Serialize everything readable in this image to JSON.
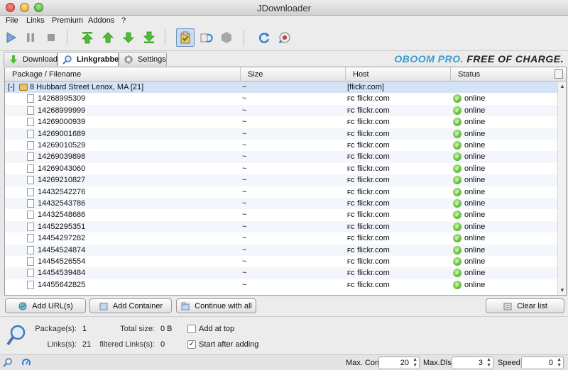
{
  "window": {
    "title": "JDownloader"
  },
  "menu": [
    "File",
    "Links",
    "Premium",
    "Addons",
    "?"
  ],
  "toolbar": {
    "icons": [
      "play-icon",
      "pause-icon",
      "stop-icon",
      "move-top-icon",
      "move-up-icon",
      "move-down-icon",
      "move-bottom-icon",
      "clipboard-observer-icon",
      "reconnect-icon",
      "premium-icon",
      "update-icon",
      "refresh-icon"
    ]
  },
  "tabs": [
    {
      "label": "Download",
      "icon": "download-arrow-icon"
    },
    {
      "label": "Linkgrabber",
      "icon": "magnifier-icon",
      "active": true
    },
    {
      "label": "Settings",
      "icon": "gear-icon"
    }
  ],
  "promo": {
    "brand": "OBOOM PRO.",
    "tagline": "FREE OF CHARGE."
  },
  "table": {
    "columns": [
      "Package / Filename",
      "Size",
      "Host",
      "Status"
    ],
    "package": {
      "toggle": "[-]",
      "name": "8 Hubbard Street Lenox, MA [21]",
      "size": "~",
      "host": "[flickr.com]"
    },
    "rows": [
      {
        "name": "14268995309",
        "size": "~",
        "host": "flickr.com",
        "status": "online"
      },
      {
        "name": "14268999999",
        "size": "~",
        "host": "flickr.com",
        "status": "online"
      },
      {
        "name": "14269000939",
        "size": "~",
        "host": "flickr.com",
        "status": "online"
      },
      {
        "name": "14269001689",
        "size": "~",
        "host": "flickr.com",
        "status": "online"
      },
      {
        "name": "14269010529",
        "size": "~",
        "host": "flickr.com",
        "status": "online"
      },
      {
        "name": "14269039898",
        "size": "~",
        "host": "flickr.com",
        "status": "online"
      },
      {
        "name": "14269043060",
        "size": "~",
        "host": "flickr.com",
        "status": "online"
      },
      {
        "name": "14269210827",
        "size": "~",
        "host": "flickr.com",
        "status": "online"
      },
      {
        "name": "14432542276",
        "size": "~",
        "host": "flickr.com",
        "status": "online"
      },
      {
        "name": "14432543786",
        "size": "~",
        "host": "flickr.com",
        "status": "online"
      },
      {
        "name": "14432548686",
        "size": "~",
        "host": "flickr.com",
        "status": "online"
      },
      {
        "name": "14452295351",
        "size": "~",
        "host": "flickr.com",
        "status": "online"
      },
      {
        "name": "14454297282",
        "size": "~",
        "host": "flickr.com",
        "status": "online"
      },
      {
        "name": "14454524874",
        "size": "~",
        "host": "flickr.com",
        "status": "online"
      },
      {
        "name": "14454526554",
        "size": "~",
        "host": "flickr.com",
        "status": "online"
      },
      {
        "name": "14454539484",
        "size": "~",
        "host": "flickr.com",
        "status": "online"
      },
      {
        "name": "14455642825",
        "size": "~",
        "host": "flickr.com",
        "status": "online"
      }
    ],
    "host_favicon": "FC"
  },
  "buttons": {
    "add_urls": "Add URL(s)",
    "add_container": "Add Container",
    "continue_all": "Continue with all",
    "clear_list": "Clear list"
  },
  "info": {
    "packages_label": "Package(s):",
    "packages_value": "1",
    "links_label": "Links(s):",
    "links_value": "21",
    "total_size_label": "Total size:",
    "total_size_value": "0 B",
    "filtered_label": "filtered Links(s):",
    "filtered_value": "0",
    "add_at_top": "Add at top",
    "add_at_top_checked": false,
    "start_after_adding": "Start after adding",
    "start_after_adding_checked": true
  },
  "statusbar": {
    "max_con_label": "Max. Con.",
    "max_con_value": "20",
    "max_dls_label": "Max.Dls.",
    "max_dls_value": "3",
    "speed_label": "Speed",
    "speed_value": "0"
  },
  "colors": {
    "accent": "#2d9fd8",
    "selection": "#d4e3f6",
    "online": "#3a9e16"
  }
}
